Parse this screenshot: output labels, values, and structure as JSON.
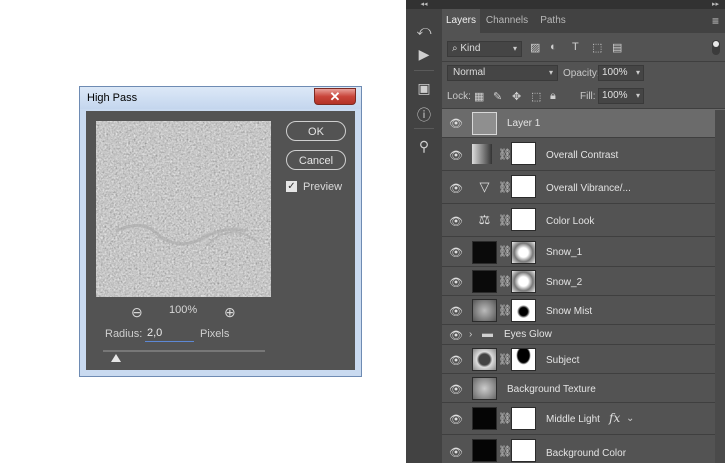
{
  "dialog": {
    "title": "High Pass",
    "close_icon": "close-icon",
    "ok_label": "OK",
    "cancel_label": "Cancel",
    "preview_label": "Preview",
    "preview_checked": true,
    "zoom_level": "100%",
    "radius_label": "Radius:",
    "radius_value": "2,0",
    "radius_unit": "Pixels",
    "radius_slider_level": 0.08
  },
  "panel": {
    "tabs": [
      {
        "label": "Layers",
        "active": true
      },
      {
        "label": "Channels",
        "active": false
      },
      {
        "label": "Paths",
        "active": false
      }
    ],
    "filter_kind": "Kind",
    "blend_mode": "Normal",
    "opacity_label": "Opacity:",
    "opacity_value": "100%",
    "lock_label": "Lock:",
    "fill_label": "Fill:",
    "fill_value": "100%",
    "layers": [
      {
        "name": "Layer 1",
        "selected": true,
        "type": "pixel"
      },
      {
        "name": "Overall Contrast",
        "type": "adjustment",
        "icon": "curves-gradient-icon"
      },
      {
        "name": "Overall Vibrance/...",
        "type": "adjustment",
        "icon": "vibrance-triangle-icon"
      },
      {
        "name": "Color Look",
        "type": "adjustment",
        "icon": "color-balance-icon"
      },
      {
        "name": "Snow_1",
        "type": "masked"
      },
      {
        "name": "Snow_2",
        "type": "masked"
      },
      {
        "name": "Snow Mist",
        "type": "masked"
      },
      {
        "name": "Eyes Glow",
        "type": "group"
      },
      {
        "name": "Subject",
        "type": "masked"
      },
      {
        "name": "Background Texture",
        "type": "pixel"
      },
      {
        "name": "Middle Light",
        "type": "masked",
        "fx": "fx"
      },
      {
        "name": "Background Color",
        "type": "masked"
      }
    ]
  }
}
